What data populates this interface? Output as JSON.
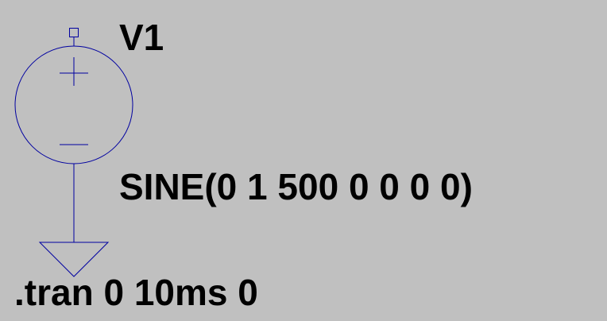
{
  "schematic": {
    "component": {
      "name": "V1",
      "value": "SINE(0 1 500 0 0 0 0)",
      "symbol": "voltage-source",
      "wire_color": "#0000a0"
    },
    "directive": ".tran 0 10ms 0",
    "background_color": "#c0c0c0",
    "text_color": "#000000"
  }
}
